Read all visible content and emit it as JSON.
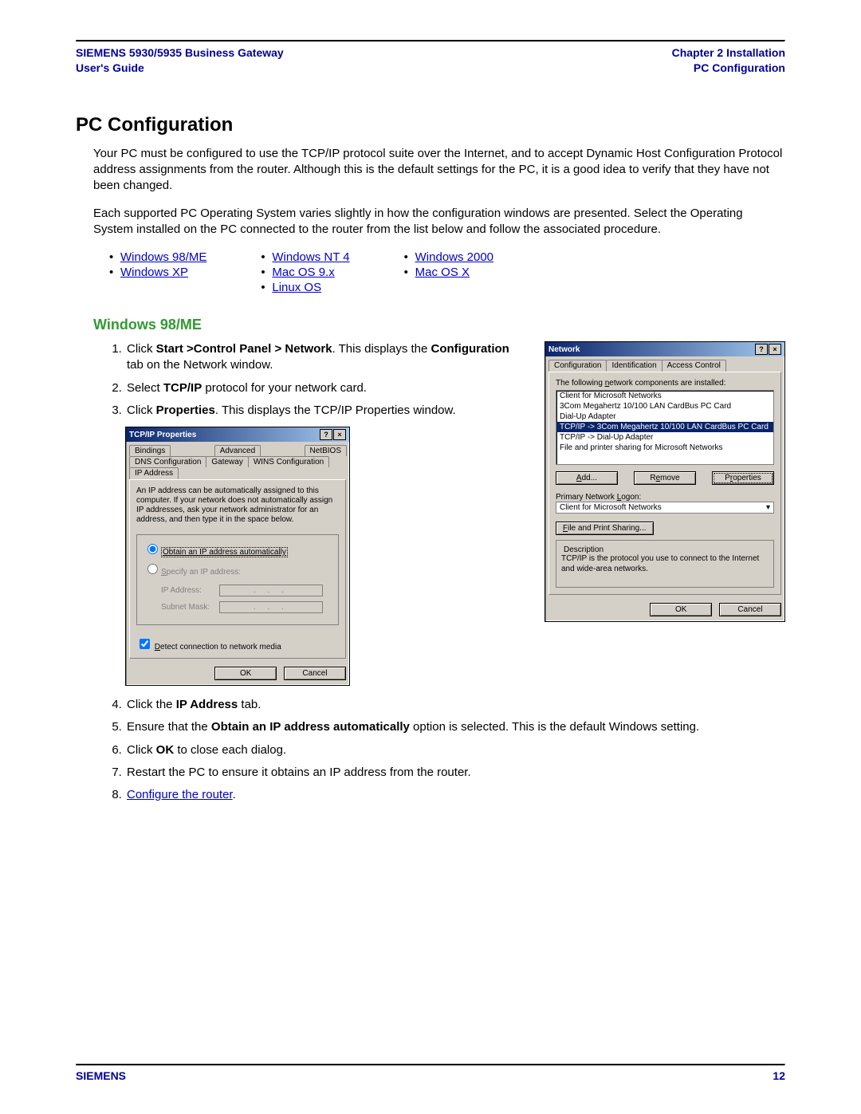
{
  "header": {
    "left_line1": "SIEMENS 5930/5935 Business Gateway",
    "left_line2": "User's Guide",
    "right_line1": "Chapter 2  Installation",
    "right_line2": "PC Configuration"
  },
  "section_title": "PC Configuration",
  "para1": "Your PC must be configured to use the TCP/IP protocol suite over the Internet, and to accept Dynamic Host Configuration Protocol address assignments from the router. Although this is the default settings for the PC, it is a good idea to verify that they have not been changed.",
  "para2": "Each supported PC Operating System varies slightly in how the configuration windows are presented. Select the Operating System installed on the PC connected to the router from the list below and follow the associated procedure.",
  "os_links": {
    "col1": [
      "Windows 98/ME",
      "Windows XP"
    ],
    "col2": [
      "Windows NT 4",
      "Mac OS 9.x",
      "Linux OS"
    ],
    "col3": [
      "Windows 2000",
      "Mac OS X"
    ]
  },
  "subhead": "Windows 98/ME",
  "steps_a": {
    "s1_pre": "Click ",
    "s1_bold": "Start >Control Panel > Network",
    "s1_post": ". This displays the ",
    "s1_bold2": "Configuration",
    "s1_post2": " tab on the Network window.",
    "s2_pre": "Select ",
    "s2_bold": "TCP/IP",
    "s2_post": " protocol for your network card.",
    "s3_pre": "Click ",
    "s3_bold": "Properties",
    "s3_post": ". This displays the TCP/IP Properties window."
  },
  "steps_b": {
    "s4_pre": "Click the ",
    "s4_bold": "IP Address",
    "s4_post": " tab.",
    "s5_pre": "Ensure that the ",
    "s5_bold": "Obtain an IP address automatically",
    "s5_post": " option is selected. This is the default Windows setting.",
    "s6_pre": "Click ",
    "s6_bold": "OK",
    "s6_post": " to close each dialog.",
    "s7": "Restart the PC to ensure it obtains an IP address from the router.",
    "s8_link": "Configure the router",
    "s8_post": "."
  },
  "tcpip_dialog": {
    "title": "TCP/IP Properties",
    "tabs_row1": [
      "Bindings",
      "Advanced",
      "NetBIOS"
    ],
    "tabs_row2": [
      "DNS Configuration",
      "Gateway",
      "WINS Configuration",
      "IP Address"
    ],
    "active_tab": "IP Address",
    "explain": "An IP address can be automatically assigned to this computer. If your network does not automatically assign IP addresses, ask your network administrator for an address, and then type it in the space below.",
    "radio_auto": "Obtain an IP address automatically",
    "radio_specify": "Specify an IP address:",
    "lbl_ip": "IP Address:",
    "lbl_mask": "Subnet Mask:",
    "ip_dots": ".   .   .",
    "detect": "Detect connection to network media",
    "ok": "OK",
    "cancel": "Cancel"
  },
  "network_dialog": {
    "title": "Network",
    "tabs": [
      "Configuration",
      "Identification",
      "Access Control"
    ],
    "active_tab": "Configuration",
    "list_label": "The following network components are installed:",
    "items": [
      "Client for Microsoft Networks",
      "3Com Megahertz 10/100 LAN CardBus PC Card",
      "Dial-Up Adapter",
      "TCP/IP -> 3Com Megahertz 10/100 LAN CardBus PC Card",
      "TCP/IP -> Dial-Up Adapter",
      "File and printer sharing for Microsoft Networks"
    ],
    "selected_index": 3,
    "btn_add": "Add...",
    "btn_remove": "Remove",
    "btn_props": "Properties",
    "primary_logon_label": "Primary Network Logon:",
    "primary_logon_value": "Client for Microsoft Networks",
    "btn_fps": "File and Print Sharing...",
    "desc_legend": "Description",
    "desc_text": "TCP/IP is the protocol you use to connect to the Internet and wide-area networks.",
    "ok": "OK",
    "cancel": "Cancel"
  },
  "footer": {
    "left": "SIEMENS",
    "right": "12"
  }
}
